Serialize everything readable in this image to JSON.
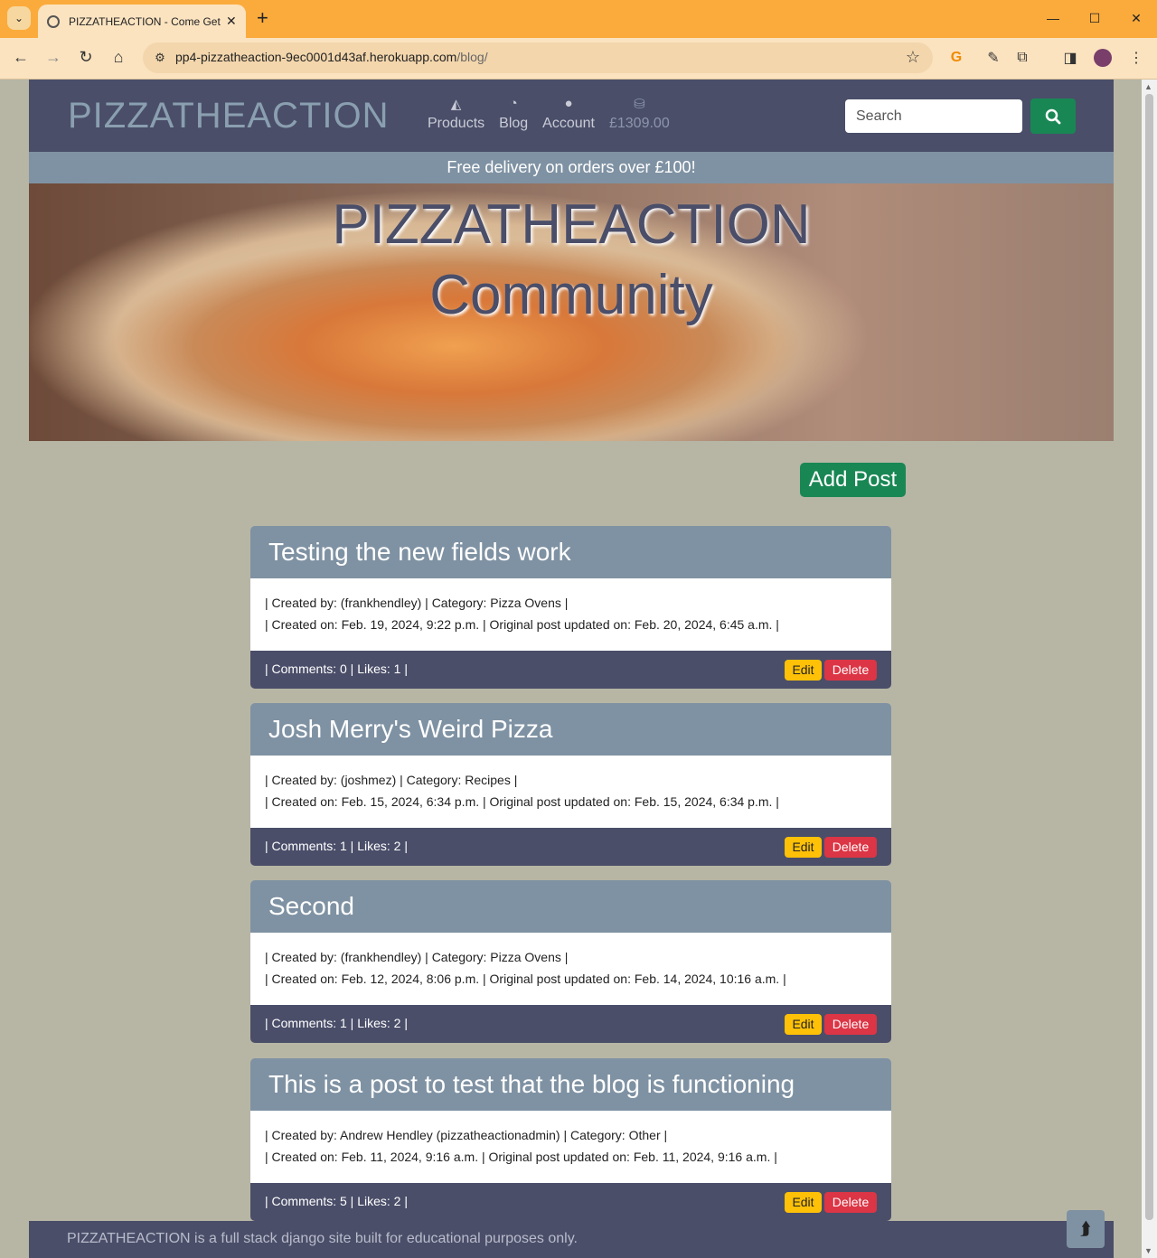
{
  "browser": {
    "tab_title": "PIZZATHEACTION - Come Get S",
    "url_main": "pp4-pizzatheaction-9ec0001d43af.herokuapp.com",
    "url_path": "/blog/"
  },
  "header": {
    "logo": "PIZZATHEACTION",
    "nav": [
      {
        "label": "Products",
        "icon": "pizza-slice-icon"
      },
      {
        "label": "Blog",
        "icon": "blog-icon"
      },
      {
        "label": "Account",
        "icon": "user-icon"
      },
      {
        "label": "£1309.00",
        "icon": "basket-icon"
      }
    ],
    "search_placeholder": "Search"
  },
  "banner_text": "Free delivery on orders over £100!",
  "hero": {
    "line1": "PIZZATHEACTION",
    "line2": "Community"
  },
  "add_post_label": "Add Post",
  "posts": [
    {
      "title": "Testing the new fields work",
      "meta1": "| Created by: (frankhendley) | Category: Pizza Ovens |",
      "meta2": "| Created on: Feb. 19, 2024, 9:22 p.m. | Original post updated on: Feb. 20, 2024, 6:45 a.m. |",
      "stats": "| Comments: 0 | Likes: 1 |"
    },
    {
      "title": "Josh Merry's Weird Pizza",
      "meta1": "| Created by: (joshmez) | Category: Recipes |",
      "meta2": "| Created on: Feb. 15, 2024, 6:34 p.m. | Original post updated on: Feb. 15, 2024, 6:34 p.m. |",
      "stats": "| Comments: 1 | Likes: 2 |"
    },
    {
      "title": "Second",
      "meta1": "| Created by: (frankhendley) | Category: Pizza Ovens |",
      "meta2": "| Created on: Feb. 12, 2024, 8:06 p.m. | Original post updated on: Feb. 14, 2024, 10:16 a.m. |",
      "stats": "| Comments: 1 | Likes: 2 |"
    },
    {
      "title": "This is a post to test that the blog is functioning",
      "meta1": "| Created by: Andrew Hendley (pizzatheactionadmin) | Category: Other |",
      "meta2": "| Created on: Feb. 11, 2024, 9:16 a.m. | Original post updated on: Feb. 11, 2024, 9:16 a.m. |",
      "stats": "| Comments: 5 | Likes: 2 |"
    }
  ],
  "buttons": {
    "edit": "Edit",
    "delete": "Delete"
  },
  "footer_text": "PIZZATHEACTION is a full stack django site built for educational purposes only.",
  "colors": {
    "header": "#4a4e69",
    "slate": "#7f92a3",
    "success": "#198754",
    "warning": "#ffc107",
    "danger": "#dc3545"
  }
}
